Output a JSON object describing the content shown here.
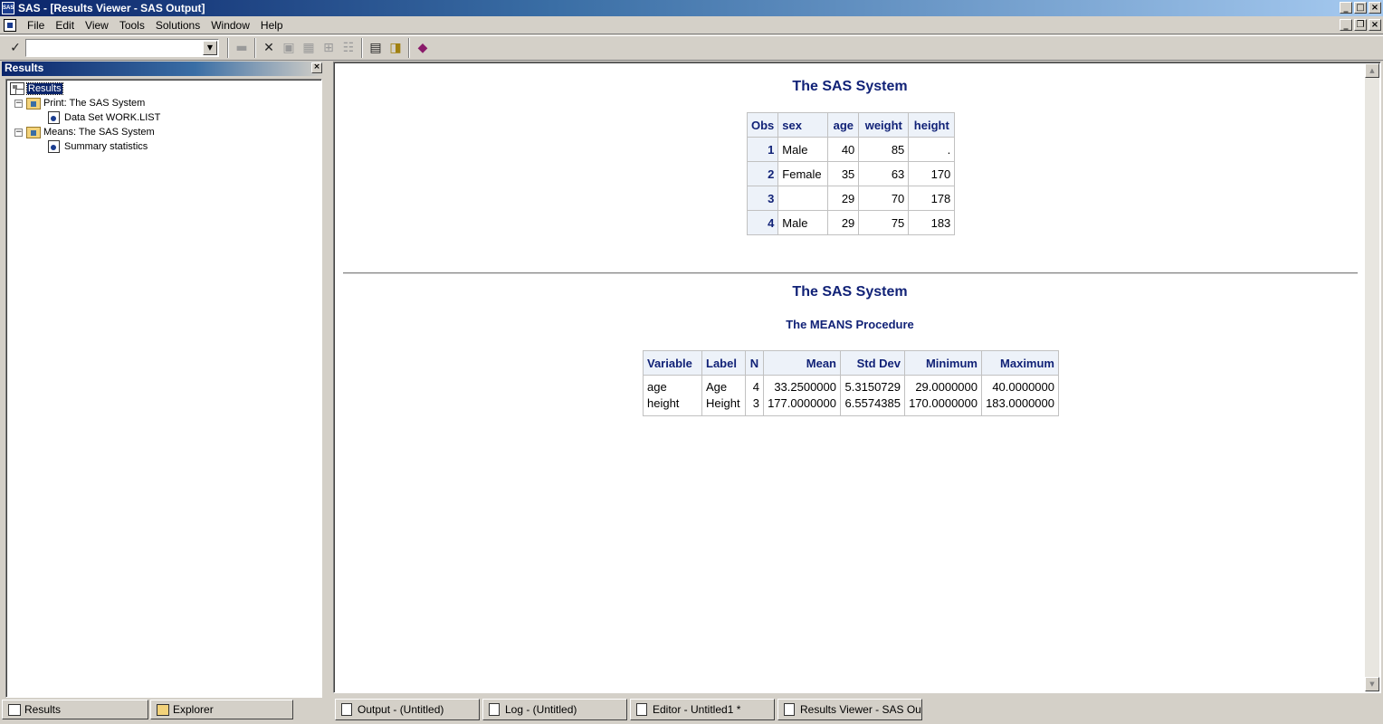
{
  "window": {
    "title": "SAS - [Results Viewer - SAS Output]",
    "app_icon_text": "SAS"
  },
  "menu": [
    "File",
    "Edit",
    "View",
    "Tools",
    "Solutions",
    "Window",
    "Help"
  ],
  "toolbar": {
    "command_value": "",
    "icons": [
      "checkmark-icon",
      "open-folder-icon",
      "delete-icon",
      "properties-icon",
      "details-icon",
      "large-icons-icon",
      "list-icon",
      "new-library-icon",
      "explorer-icon",
      "help-book-icon"
    ]
  },
  "results_panel": {
    "title": "Results",
    "tree": [
      {
        "label": "Results",
        "level": 0,
        "selected": true
      },
      {
        "label": "Print:  The SAS System",
        "level": 1
      },
      {
        "label": "Data Set WORK.LIST",
        "level": 2
      },
      {
        "label": "Means:  The SAS System",
        "level": 1
      },
      {
        "label": "Summary statistics",
        "level": 2
      }
    ],
    "tabs": [
      "Results",
      "Explorer"
    ]
  },
  "output": {
    "print": {
      "title": "The SAS System",
      "columns": [
        "Obs",
        "sex",
        "age",
        "weight",
        "height"
      ],
      "rows": [
        [
          "1",
          "Male",
          "40",
          "85",
          "."
        ],
        [
          "2",
          "Female",
          "35",
          "63",
          "170"
        ],
        [
          "3",
          "",
          "29",
          "70",
          "178"
        ],
        [
          "4",
          "Male",
          "29",
          "75",
          "183"
        ]
      ]
    },
    "means": {
      "title": "The SAS System",
      "subtitle": "The MEANS Procedure",
      "columns": [
        "Variable",
        "Label",
        "N",
        "Mean",
        "Std Dev",
        "Minimum",
        "Maximum"
      ],
      "rows": [
        [
          "age",
          "Age",
          "4",
          "33.2500000",
          "5.3150729",
          "29.0000000",
          "40.0000000"
        ],
        [
          "height",
          "Height",
          "3",
          "177.0000000",
          "6.5574385",
          "170.0000000",
          "183.0000000"
        ]
      ]
    }
  },
  "taskbar": [
    "Output - (Untitled)",
    "Log - (Untitled)",
    "Editor - Untitled1 *",
    "Results Viewer - SAS Out..."
  ]
}
